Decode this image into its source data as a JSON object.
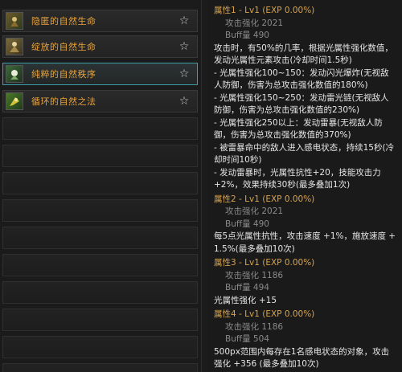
{
  "skills": [
    {
      "label": "隐匿的自然生命",
      "icon": "nature-life-hidden-icon",
      "selected": false,
      "favorite_icon": "star-outline-icon"
    },
    {
      "label": "绽放的自然生命",
      "icon": "nature-life-bloom-icon",
      "selected": false,
      "favorite_icon": "star-outline-icon"
    },
    {
      "label": "纯粹的自然秩序",
      "icon": "nature-order-icon",
      "selected": true,
      "favorite_icon": "star-outline-icon"
    },
    {
      "label": "循环的自然之法",
      "icon": "nature-cycle-icon",
      "selected": false,
      "favorite_icon": "star-outline-icon"
    }
  ],
  "empty_slots": 10,
  "colors": {
    "skill_label": "#e8a33c",
    "selected_border": "#3aa0a6",
    "heading": "#d9a34a",
    "stat": "#8a8a8a",
    "text": "#e6e6e6"
  },
  "details": [
    {
      "heading": "属性1 - Lv1 (EXP 0.00%)",
      "stats": [
        "攻击强化 2021",
        "Buff量 490"
      ],
      "lines": [
        "攻击时，有50%的几率，根据光属性强化数值，发动光属性元素攻击(冷却时间1.5秒)",
        "- 光属性强化100~150：发动闪光爆炸(无视敌人防御，伤害为总攻击强化数值的180%)",
        "- 光属性强化150~250：发动雷光链(无视敌人防御，伤害为总攻击强化数值的230%)",
        "- 光属性强化250以上：发动雷暴(无视敌人防御，伤害为总攻击强化数值的370%)",
        "- 被雷暴命中的敌人进入感电状态，持续15秒(冷却时间10秒)",
        "- 发动雷暴时，光属性抗性+20，技能攻击力 +2%，效果持续30秒(最多叠加1次)"
      ]
    },
    {
      "heading": "属性2 - Lv1 (EXP 0.00%)",
      "stats": [
        "攻击强化 2021",
        "Buff量 490"
      ],
      "lines": [
        "每5点光属性抗性，攻击速度 +1%，施放速度 + 1.5%(最多叠加10次)"
      ]
    },
    {
      "heading": "属性3 - Lv1 (EXP 0.00%)",
      "stats": [
        "攻击强化 1186",
        "Buff量 494"
      ],
      "lines": [
        "光属性强化 +15"
      ]
    },
    {
      "heading": "属性4 - Lv1 (EXP 0.00%)",
      "stats": [
        "攻击强化 1186",
        "Buff量 504"
      ],
      "lines": [
        "500px范围内每存在1名感电状态的对象，攻击强化 +356 (最多叠加10次)"
      ]
    }
  ]
}
